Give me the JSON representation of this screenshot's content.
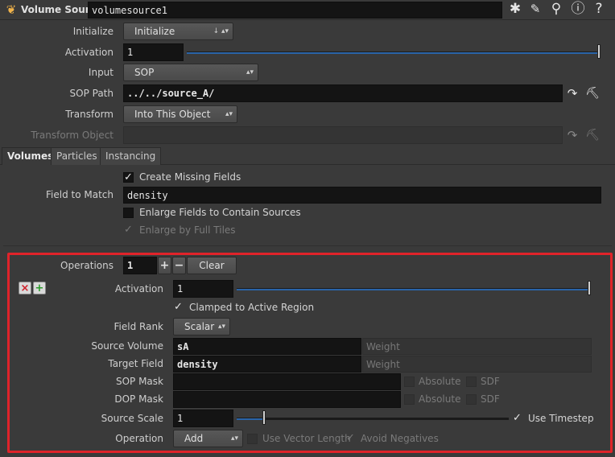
{
  "header": {
    "node_type": "Volume Source",
    "node_name": "volumesource1"
  },
  "top": {
    "initialize_label": "Initialize",
    "initialize_value": "Initialize",
    "activation_label": "Activation",
    "activation_value": "1",
    "input_label": "Input",
    "input_value": "SOP",
    "sop_path_label": "SOP Path",
    "sop_path_value": "../../source_A/",
    "transform_label": "Transform",
    "transform_value": "Into This Object",
    "transform_object_label": "Transform Object",
    "transform_object_value": ""
  },
  "tabs": [
    {
      "label": "Volumes",
      "active": true
    },
    {
      "label": "Particles",
      "active": false
    },
    {
      "label": "Instancing",
      "active": false
    }
  ],
  "volumes": {
    "create_missing_label": "Create Missing Fields",
    "create_missing_checked": true,
    "field_to_match_label": "Field to Match",
    "field_to_match_value": "density",
    "enlarge_fields_label": "Enlarge Fields to Contain Sources",
    "enlarge_fields_checked": false,
    "enlarge_full_tiles_label": "Enlarge by Full Tiles",
    "enlarge_full_tiles_checked": true
  },
  "operations": {
    "label": "Operations",
    "count": "1",
    "add_symbol": "+",
    "remove_symbol": "−",
    "clear_label": "Clear",
    "delete_symbol": "×",
    "insert_symbol": "+",
    "activation_label": "Activation",
    "activation_value": "1",
    "clamped_label": "Clamped to Active Region",
    "clamped_checked": true,
    "field_rank_label": "Field Rank",
    "field_rank_value": "Scalar",
    "source_volume_label": "Source Volume",
    "source_volume_value": "sA",
    "source_weight_placeholder": "Weight",
    "target_field_label": "Target Field",
    "target_field_value": "density",
    "target_weight_placeholder": "Weight",
    "sop_mask_label": "SOP Mask",
    "sop_mask_value": "",
    "dop_mask_label": "DOP Mask",
    "dop_mask_value": "",
    "absolute_label": "Absolute",
    "sdf_label": "SDF",
    "source_scale_label": "Source Scale",
    "source_scale_value": "1",
    "use_timestep_label": "Use Timestep",
    "use_timestep_checked": true,
    "operation_label": "Operation",
    "operation_value": "Add",
    "use_vector_length_label": "Use Vector Length",
    "avoid_negatives_label": "Avoid Negatives"
  },
  "colors": {
    "highlight_border": "#e0232a",
    "slider_fill": "#2a64a8",
    "background": "#3a3a3a"
  }
}
